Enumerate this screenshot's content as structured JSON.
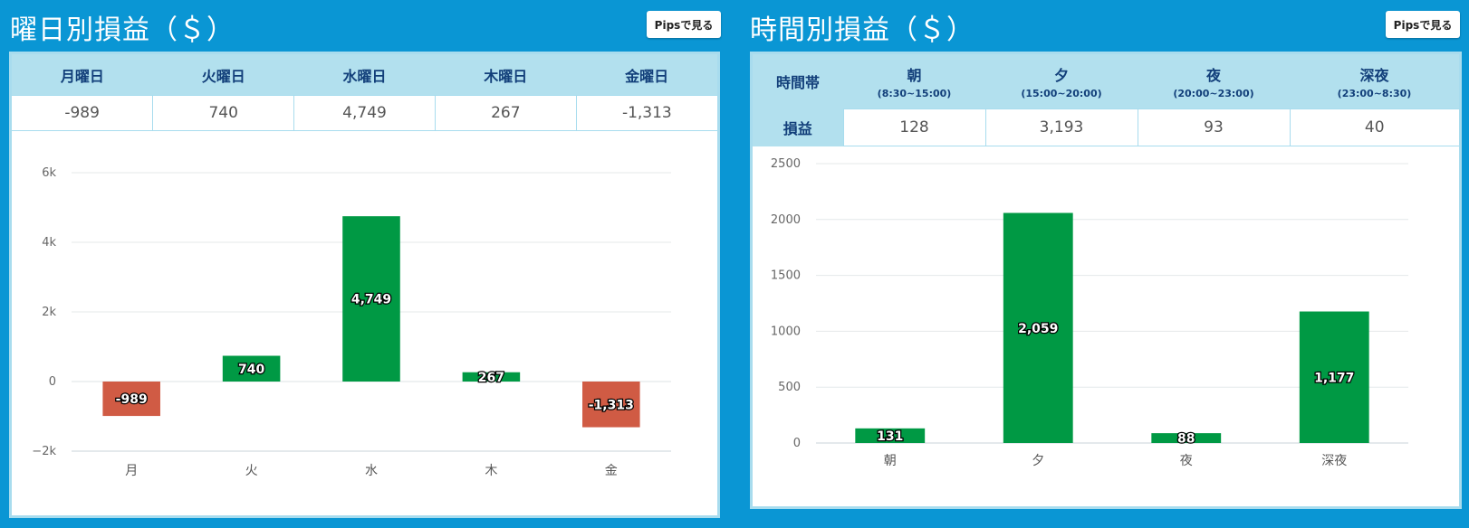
{
  "left": {
    "title": "曜日別損益（＄）",
    "pips_button": "Pipsで見る",
    "table": {
      "headers": [
        "月曜日",
        "火曜日",
        "水曜日",
        "木曜日",
        "金曜日"
      ],
      "values": [
        "-989",
        "740",
        "4,749",
        "267",
        "-1,313"
      ]
    }
  },
  "right": {
    "title": "時間別損益（＄）",
    "pips_button": "Pipsで見る",
    "table": {
      "corner_header": "時間帯",
      "row_label": "損益",
      "headers": [
        {
          "name": "朝",
          "range": "(8:30~15:00)"
        },
        {
          "name": "夕",
          "range": "(15:00~20:00)"
        },
        {
          "name": "夜",
          "range": "(20:00~23:00)"
        },
        {
          "name": "深夜",
          "range": "(23:00~8:30)"
        }
      ],
      "values": [
        "128",
        "3,193",
        "93",
        "40"
      ]
    }
  },
  "chart_data": [
    {
      "type": "bar",
      "categories": [
        "月",
        "火",
        "水",
        "木",
        "金"
      ],
      "values": [
        -989,
        740,
        4749,
        267,
        -1313
      ],
      "value_labels": [
        "-989",
        "740",
        "4,749",
        "267",
        "-1,313"
      ],
      "ylim": [
        -2000,
        6000
      ],
      "yticks": [
        -2000,
        0,
        2000,
        4000,
        6000
      ],
      "ytick_labels": [
        "−2k",
        "0",
        "2k",
        "4k",
        "6k"
      ],
      "grid": true,
      "colors": {
        "positive": "#009944",
        "negative": "#d05b44"
      }
    },
    {
      "type": "bar",
      "categories": [
        "朝",
        "夕",
        "夜",
        "深夜"
      ],
      "values": [
        131,
        2059,
        88,
        1177
      ],
      "value_labels": [
        "131",
        "2,059",
        "88",
        "1,177"
      ],
      "ylim": [
        0,
        2500
      ],
      "yticks": [
        0,
        500,
        1000,
        1500,
        2000,
        2500
      ],
      "ytick_labels": [
        "0",
        "500",
        "1000",
        "1500",
        "2000",
        "2500"
      ],
      "grid": true,
      "colors": {
        "positive": "#009944",
        "negative": "#d05b44"
      }
    }
  ]
}
